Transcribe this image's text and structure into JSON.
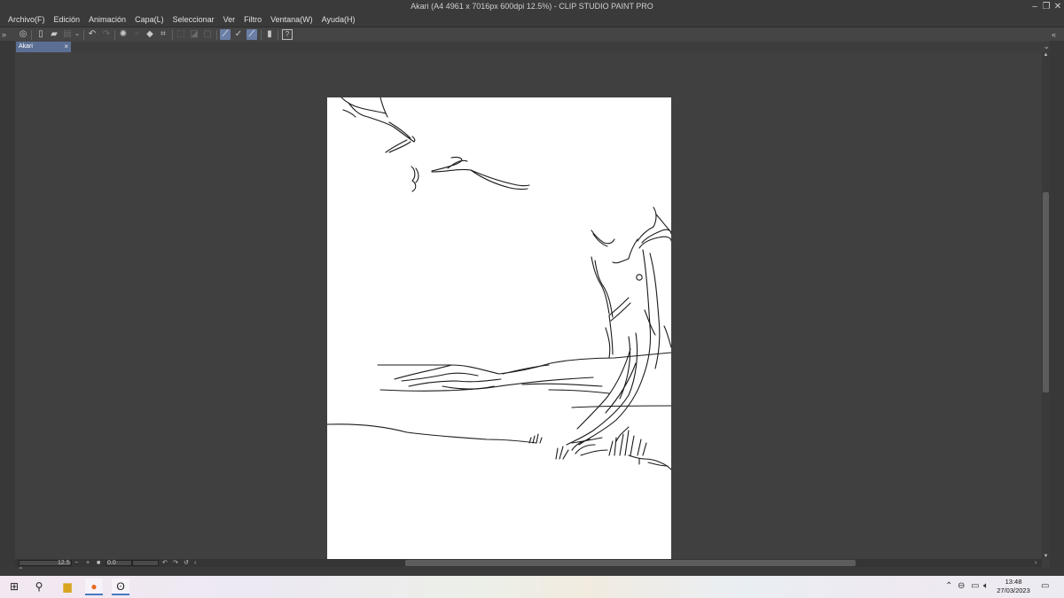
{
  "window": {
    "title": "Akari (A4 4961 x 7016px 600dpi 12.5%)  - CLIP STUDIO PAINT PRO",
    "controls": [
      "–",
      "❐",
      "✕"
    ]
  },
  "menu": [
    "Archivo(F)",
    "Edición",
    "Animación",
    "Capa(L)",
    "Seleccionar",
    "Ver",
    "Filtro",
    "Ventana(W)",
    "Ayuda(H)"
  ],
  "document_tab": {
    "label": "Akari",
    "close": "×"
  },
  "status": {
    "zoom": "12.5",
    "minus": "−",
    "plus": "+",
    "angle": "0.0"
  },
  "taskbar": {
    "time": "13:48",
    "date": "27/03/2023"
  }
}
